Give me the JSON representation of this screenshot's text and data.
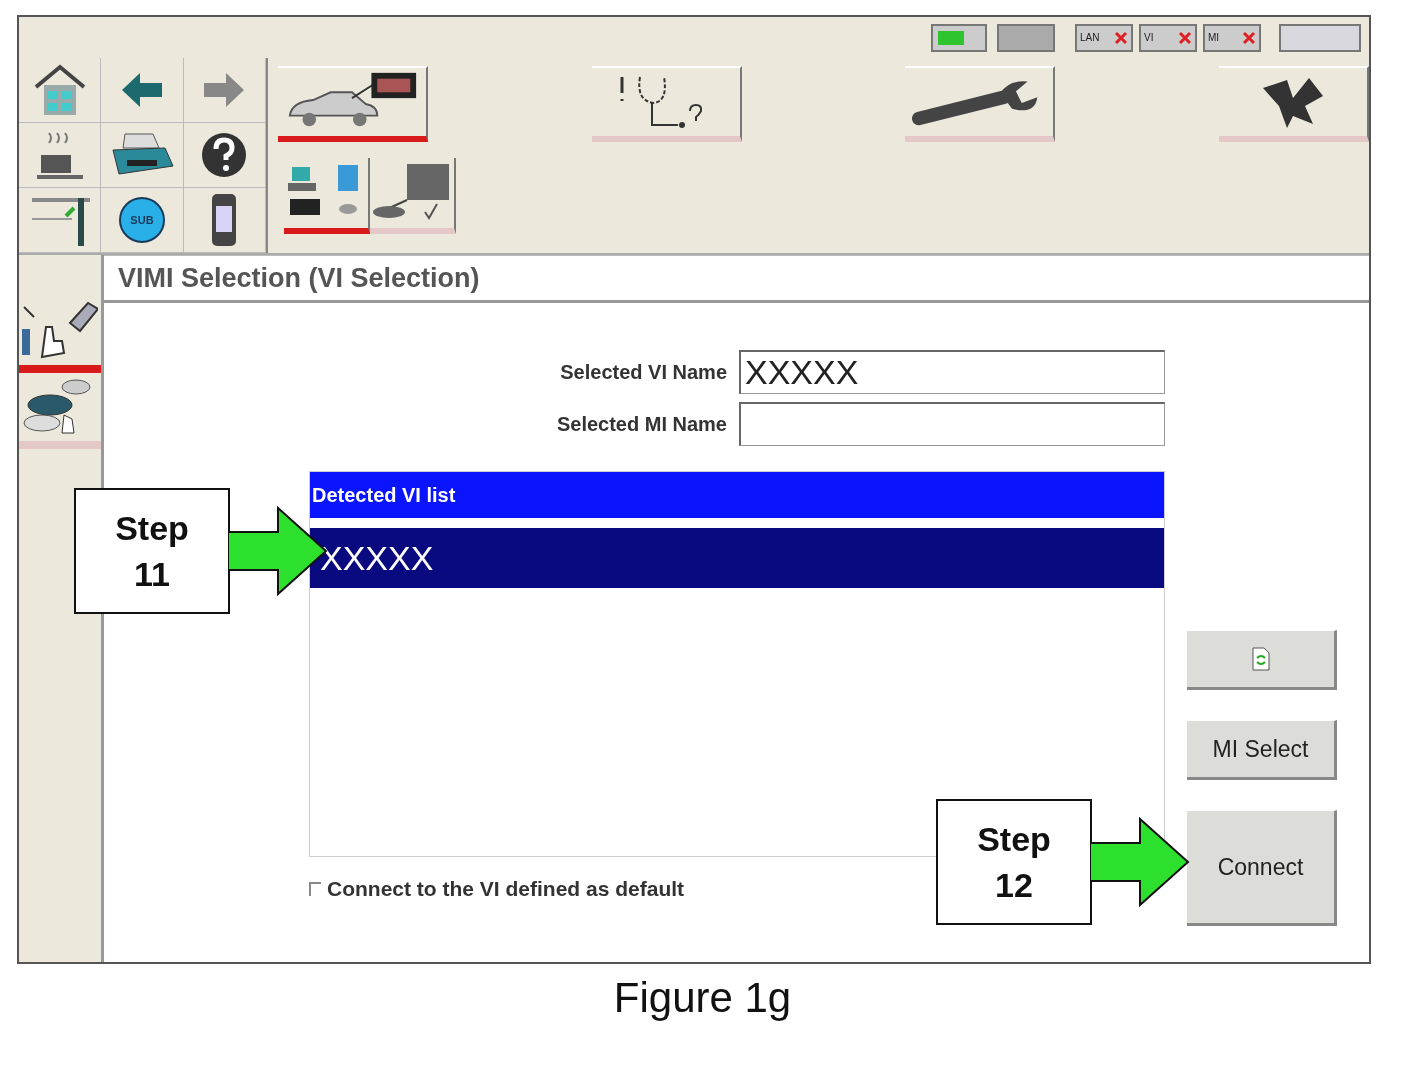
{
  "status_indicators": [
    {
      "kind": "pc",
      "connected": true
    },
    {
      "kind": "blank"
    },
    {
      "kind": "lan",
      "label": "LAN",
      "connected": false
    },
    {
      "kind": "vi",
      "label": "VI",
      "connected": false
    },
    {
      "kind": "mi",
      "label": "MI",
      "connected": false
    },
    {
      "kind": "blank-wide"
    }
  ],
  "nav_icons": [
    {
      "kind": "home"
    },
    {
      "kind": "back"
    },
    {
      "kind": "forward"
    },
    {
      "kind": "coffee"
    },
    {
      "kind": "printer"
    },
    {
      "kind": "help"
    },
    {
      "kind": "screen"
    },
    {
      "kind": "sub",
      "label": "SUB"
    },
    {
      "kind": "phone"
    }
  ],
  "tool_buttons": [
    {
      "kind": "car-ecu",
      "selected": true
    },
    {
      "kind": "stethoscope",
      "selected": false
    },
    {
      "kind": "wrench",
      "selected": false
    },
    {
      "kind": "parts",
      "selected": false
    }
  ],
  "sub_buttons": [
    {
      "kind": "pc-connect",
      "selected": true
    },
    {
      "kind": "screen-check",
      "selected": false
    }
  ],
  "side_items": [
    {
      "kind": "hand-device",
      "selected": true
    },
    {
      "kind": "cars",
      "selected": false
    }
  ],
  "title": "VIMI Selection (VI Selection)",
  "fields": [
    {
      "label": "Selected VI Name",
      "value": "XXXXX"
    },
    {
      "label": "Selected MI Name"
    }
  ],
  "vi_list": {
    "header": "Detected VI list",
    "rows": [
      {
        "text": "XXXXX",
        "selected": true
      }
    ]
  },
  "default_checkbox": {
    "label": "Connect to the VI defined as default",
    "checked": false
  },
  "buttons": [
    {
      "kind": "refresh"
    },
    {
      "kind": "text",
      "label": "MI Select"
    },
    {
      "kind": "text",
      "label": "Connect"
    }
  ],
  "callouts": [
    {
      "lines": [
        "Step",
        "11"
      ]
    },
    {
      "lines": [
        "Step",
        "12"
      ]
    }
  ],
  "caption": "Figure 1g"
}
